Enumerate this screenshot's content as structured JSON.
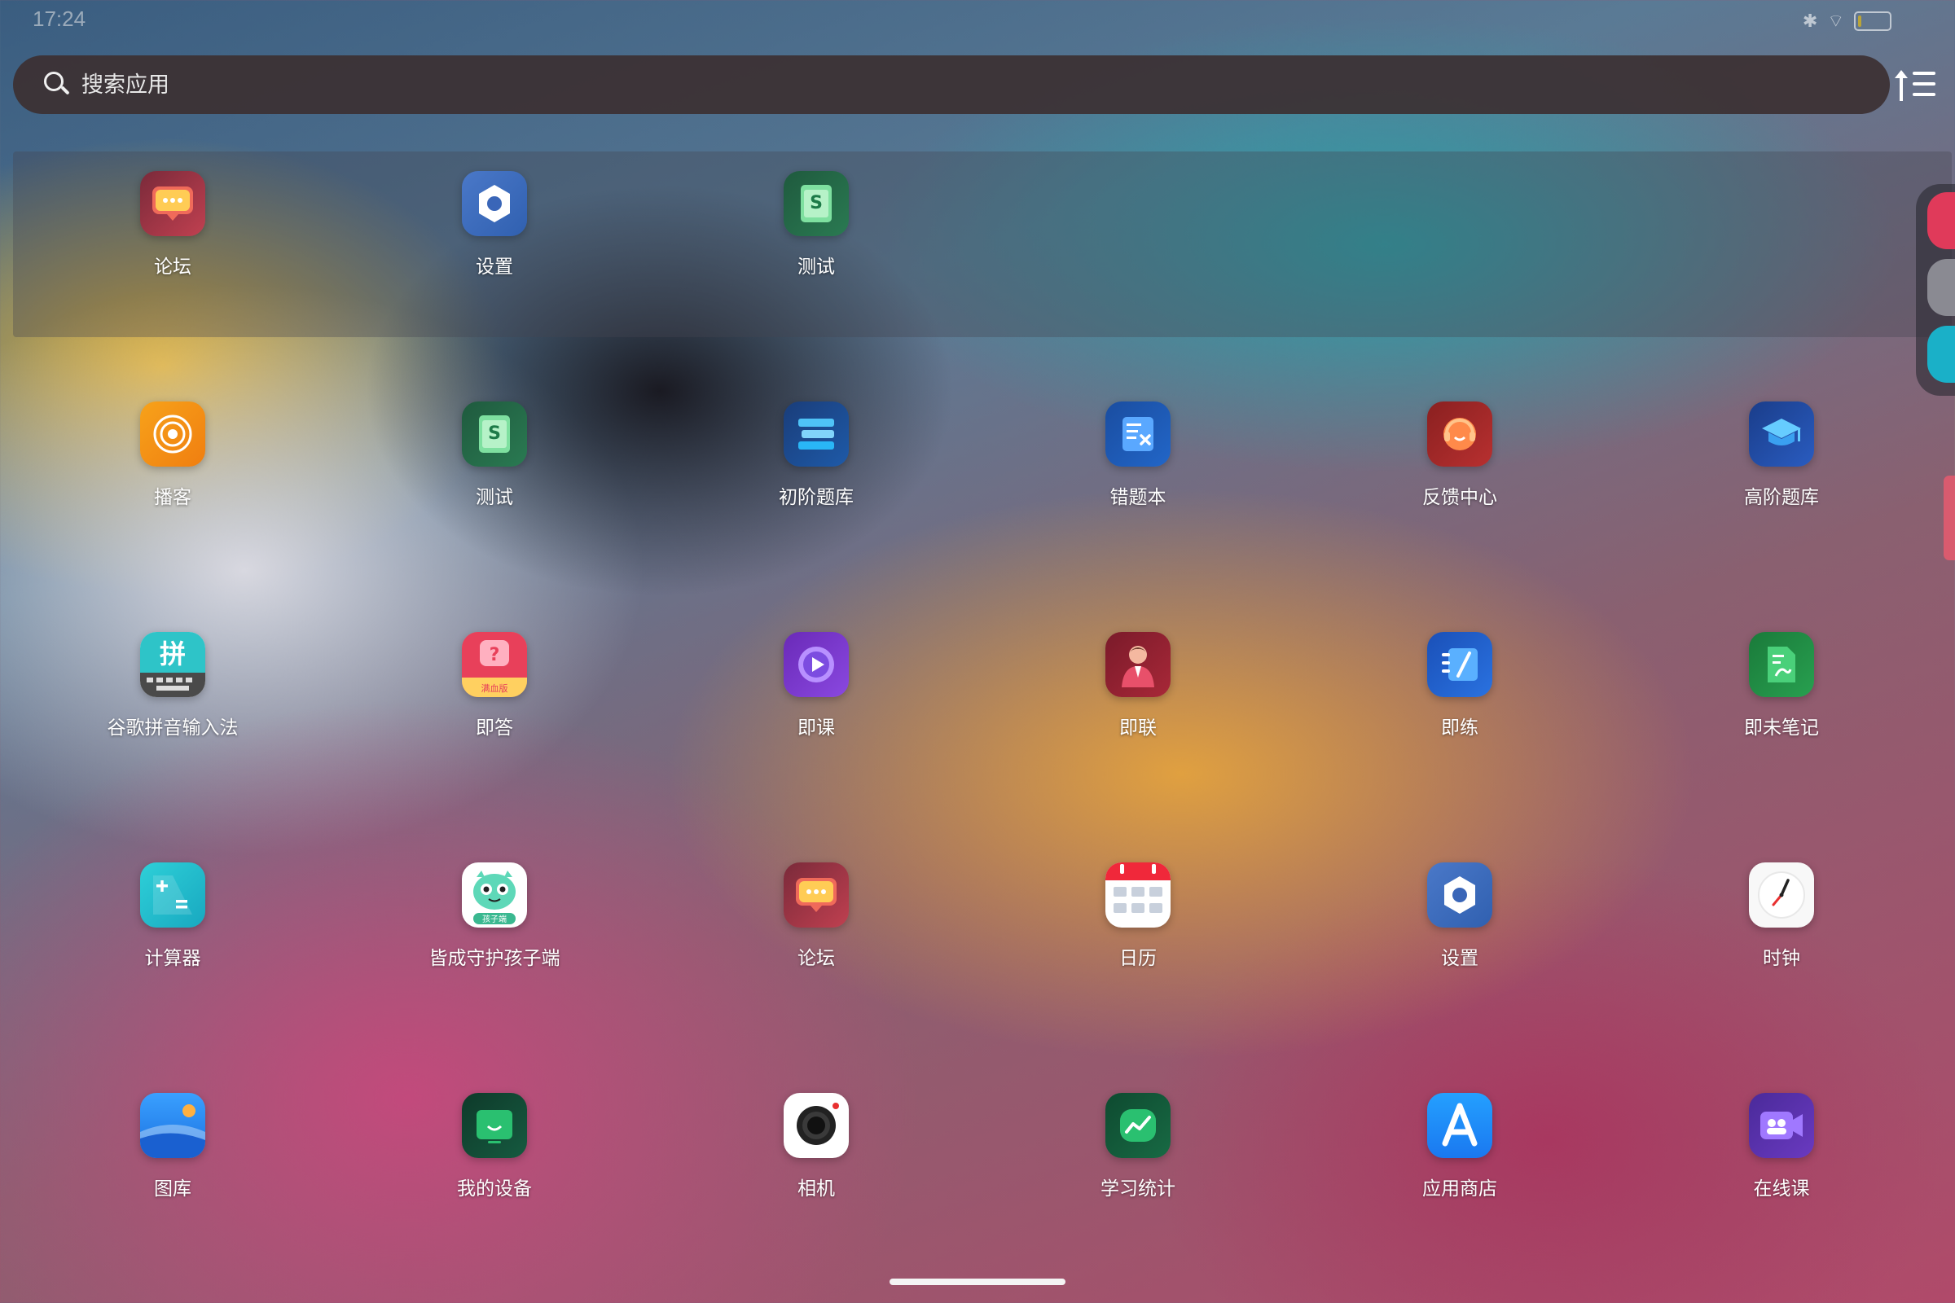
{
  "status": {
    "time": "17:24",
    "icons": [
      "bluetooth-icon",
      "wifi-icon",
      "battery-icon"
    ]
  },
  "search": {
    "placeholder": "搜索应用"
  },
  "recent_apps": [
    {
      "label": "论坛",
      "icon": "forum-icon"
    },
    {
      "label": "设置",
      "icon": "settings-icon"
    },
    {
      "label": "测试",
      "icon": "test-icon"
    }
  ],
  "apps": [
    {
      "label": "播客",
      "icon": "podcast-icon"
    },
    {
      "label": "测试",
      "icon": "test-icon"
    },
    {
      "label": "初阶题库",
      "icon": "basic-question-bank-icon"
    },
    {
      "label": "错题本",
      "icon": "mistake-book-icon"
    },
    {
      "label": "反馈中心",
      "icon": "feedback-center-icon"
    },
    {
      "label": "高阶题库",
      "icon": "advanced-question-bank-icon"
    },
    {
      "label": "谷歌拼音输入法",
      "icon": "google-pinyin-icon"
    },
    {
      "label": "即答",
      "icon": "jida-icon"
    },
    {
      "label": "即课",
      "icon": "jike-icon"
    },
    {
      "label": "即联",
      "icon": "jilian-icon"
    },
    {
      "label": "即练",
      "icon": "jilian-practice-icon"
    },
    {
      "label": "即未笔记",
      "icon": "notes-icon"
    },
    {
      "label": "计算器",
      "icon": "calculator-icon"
    },
    {
      "label": "皆成守护孩子端",
      "icon": "child-guard-icon"
    },
    {
      "label": "论坛",
      "icon": "forum-icon"
    },
    {
      "label": "日历",
      "icon": "calendar-icon"
    },
    {
      "label": "设置",
      "icon": "settings-icon"
    },
    {
      "label": "时钟",
      "icon": "clock-icon"
    },
    {
      "label": "图库",
      "icon": "gallery-icon"
    },
    {
      "label": "我的设备",
      "icon": "my-device-icon"
    },
    {
      "label": "相机",
      "icon": "camera-icon"
    },
    {
      "label": "学习统计",
      "icon": "study-stats-icon"
    },
    {
      "label": "应用商店",
      "icon": "app-store-icon"
    },
    {
      "label": "在线课",
      "icon": "online-class-icon"
    }
  ],
  "colors": {
    "scroll_handle": "#e65a6e",
    "search_bar": "#3c3032"
  }
}
